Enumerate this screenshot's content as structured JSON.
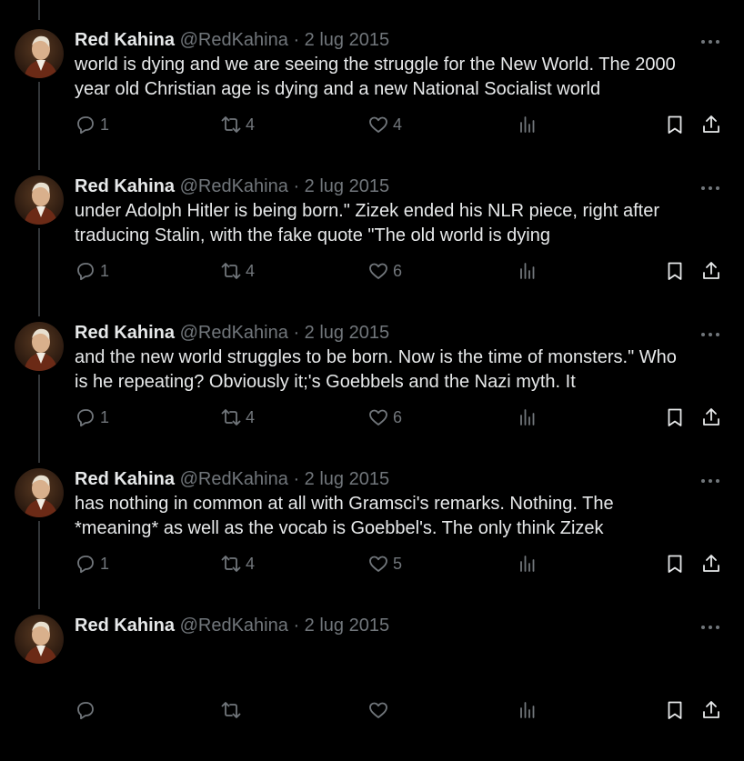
{
  "theme": {
    "background": "#000000",
    "text": "#e7e9ea",
    "muted": "#71767b",
    "thread_line": "#333639"
  },
  "tweets": [
    {
      "name": "Red Kahina",
      "handle": "@RedKahina",
      "separator": "·",
      "date": "2 lug 2015",
      "lines": [
        "world is dying and we are seeing the struggle for the New World. The 2000",
        "year old Christian age is dying and a new National Socialist world"
      ],
      "replies": "1",
      "retweets": "4",
      "likes": "4"
    },
    {
      "name": "Red Kahina",
      "handle": "@RedKahina",
      "separator": "·",
      "date": "2 lug 2015",
      "lines": [
        "under Adolph Hitler is being born.\" Zizek ended his NLR piece, right after",
        "traducing Stalin, with the fake quote \"The old world is dying"
      ],
      "replies": "1",
      "retweets": "4",
      "likes": "6"
    },
    {
      "name": "Red Kahina",
      "handle": "@RedKahina",
      "separator": "·",
      "date": "2 lug 2015",
      "lines": [
        "and the new world struggles to be born. Now is the time of monsters.\" Who",
        "is he repeating? Obviously it;'s Goebbels and the Nazi myth. It"
      ],
      "replies": "1",
      "retweets": "4",
      "likes": "6"
    },
    {
      "name": "Red Kahina",
      "handle": "@RedKahina",
      "separator": "·",
      "date": "2 lug 2015",
      "lines": [
        "has nothing in common at all with Gramsci's remarks. Nothing. The",
        "*meaning* as well as the vocab is Goebbel's. The only think Zizek"
      ],
      "replies": "1",
      "retweets": "4",
      "likes": "5"
    },
    {
      "name": "Red Kahina",
      "handle": "@RedKahina",
      "separator": "·",
      "date": "2 lug 2015",
      "lines": [],
      "replies": "",
      "retweets": "",
      "likes": ""
    }
  ],
  "icons": {
    "reply": "reply-icon",
    "retweet": "retweet-icon",
    "like": "heart-icon",
    "views": "views-chart-icon",
    "bookmark": "bookmark-icon",
    "share": "share-icon",
    "more": "more-dots-icon"
  }
}
